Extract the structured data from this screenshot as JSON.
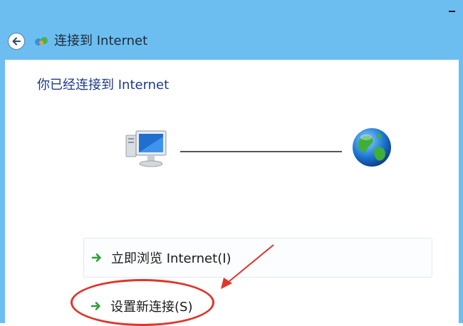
{
  "window": {
    "title": "连接到 Internet"
  },
  "main": {
    "heading": "你已经连接到 Internet",
    "options": [
      {
        "label": "立即浏览 Internet(I)"
      },
      {
        "label": "设置新连接(S)"
      }
    ]
  },
  "icons": {
    "back": "back-arrow-icon",
    "window": "network-connection-icon",
    "computer": "computer-icon",
    "globe": "globe-icon",
    "option_arrow": "green-arrow-icon"
  },
  "colors": {
    "titlebar": "#6cbef0",
    "heading_text": "#1e3a8a",
    "option_arrow": "#2e9e3a",
    "annotation": "#e0352b"
  }
}
